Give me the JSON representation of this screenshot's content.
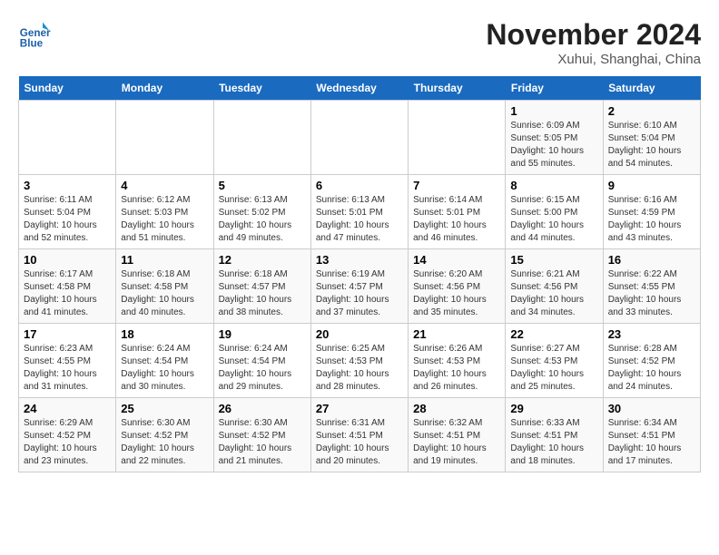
{
  "header": {
    "logo_text_line1": "General",
    "logo_text_line2": "Blue",
    "month_title": "November 2024",
    "location": "Xuhui, Shanghai, China"
  },
  "weekdays": [
    "Sunday",
    "Monday",
    "Tuesday",
    "Wednesday",
    "Thursday",
    "Friday",
    "Saturday"
  ],
  "weeks": [
    [
      {
        "day": "",
        "sunrise": "",
        "sunset": "",
        "daylight": ""
      },
      {
        "day": "",
        "sunrise": "",
        "sunset": "",
        "daylight": ""
      },
      {
        "day": "",
        "sunrise": "",
        "sunset": "",
        "daylight": ""
      },
      {
        "day": "",
        "sunrise": "",
        "sunset": "",
        "daylight": ""
      },
      {
        "day": "",
        "sunrise": "",
        "sunset": "",
        "daylight": ""
      },
      {
        "day": "1",
        "sunrise": "Sunrise: 6:09 AM",
        "sunset": "Sunset: 5:05 PM",
        "daylight": "Daylight: 10 hours and 55 minutes."
      },
      {
        "day": "2",
        "sunrise": "Sunrise: 6:10 AM",
        "sunset": "Sunset: 5:04 PM",
        "daylight": "Daylight: 10 hours and 54 minutes."
      }
    ],
    [
      {
        "day": "3",
        "sunrise": "Sunrise: 6:11 AM",
        "sunset": "Sunset: 5:04 PM",
        "daylight": "Daylight: 10 hours and 52 minutes."
      },
      {
        "day": "4",
        "sunrise": "Sunrise: 6:12 AM",
        "sunset": "Sunset: 5:03 PM",
        "daylight": "Daylight: 10 hours and 51 minutes."
      },
      {
        "day": "5",
        "sunrise": "Sunrise: 6:13 AM",
        "sunset": "Sunset: 5:02 PM",
        "daylight": "Daylight: 10 hours and 49 minutes."
      },
      {
        "day": "6",
        "sunrise": "Sunrise: 6:13 AM",
        "sunset": "Sunset: 5:01 PM",
        "daylight": "Daylight: 10 hours and 47 minutes."
      },
      {
        "day": "7",
        "sunrise": "Sunrise: 6:14 AM",
        "sunset": "Sunset: 5:01 PM",
        "daylight": "Daylight: 10 hours and 46 minutes."
      },
      {
        "day": "8",
        "sunrise": "Sunrise: 6:15 AM",
        "sunset": "Sunset: 5:00 PM",
        "daylight": "Daylight: 10 hours and 44 minutes."
      },
      {
        "day": "9",
        "sunrise": "Sunrise: 6:16 AM",
        "sunset": "Sunset: 4:59 PM",
        "daylight": "Daylight: 10 hours and 43 minutes."
      }
    ],
    [
      {
        "day": "10",
        "sunrise": "Sunrise: 6:17 AM",
        "sunset": "Sunset: 4:58 PM",
        "daylight": "Daylight: 10 hours and 41 minutes."
      },
      {
        "day": "11",
        "sunrise": "Sunrise: 6:18 AM",
        "sunset": "Sunset: 4:58 PM",
        "daylight": "Daylight: 10 hours and 40 minutes."
      },
      {
        "day": "12",
        "sunrise": "Sunrise: 6:18 AM",
        "sunset": "Sunset: 4:57 PM",
        "daylight": "Daylight: 10 hours and 38 minutes."
      },
      {
        "day": "13",
        "sunrise": "Sunrise: 6:19 AM",
        "sunset": "Sunset: 4:57 PM",
        "daylight": "Daylight: 10 hours and 37 minutes."
      },
      {
        "day": "14",
        "sunrise": "Sunrise: 6:20 AM",
        "sunset": "Sunset: 4:56 PM",
        "daylight": "Daylight: 10 hours and 35 minutes."
      },
      {
        "day": "15",
        "sunrise": "Sunrise: 6:21 AM",
        "sunset": "Sunset: 4:56 PM",
        "daylight": "Daylight: 10 hours and 34 minutes."
      },
      {
        "day": "16",
        "sunrise": "Sunrise: 6:22 AM",
        "sunset": "Sunset: 4:55 PM",
        "daylight": "Daylight: 10 hours and 33 minutes."
      }
    ],
    [
      {
        "day": "17",
        "sunrise": "Sunrise: 6:23 AM",
        "sunset": "Sunset: 4:55 PM",
        "daylight": "Daylight: 10 hours and 31 minutes."
      },
      {
        "day": "18",
        "sunrise": "Sunrise: 6:24 AM",
        "sunset": "Sunset: 4:54 PM",
        "daylight": "Daylight: 10 hours and 30 minutes."
      },
      {
        "day": "19",
        "sunrise": "Sunrise: 6:24 AM",
        "sunset": "Sunset: 4:54 PM",
        "daylight": "Daylight: 10 hours and 29 minutes."
      },
      {
        "day": "20",
        "sunrise": "Sunrise: 6:25 AM",
        "sunset": "Sunset: 4:53 PM",
        "daylight": "Daylight: 10 hours and 28 minutes."
      },
      {
        "day": "21",
        "sunrise": "Sunrise: 6:26 AM",
        "sunset": "Sunset: 4:53 PM",
        "daylight": "Daylight: 10 hours and 26 minutes."
      },
      {
        "day": "22",
        "sunrise": "Sunrise: 6:27 AM",
        "sunset": "Sunset: 4:53 PM",
        "daylight": "Daylight: 10 hours and 25 minutes."
      },
      {
        "day": "23",
        "sunrise": "Sunrise: 6:28 AM",
        "sunset": "Sunset: 4:52 PM",
        "daylight": "Daylight: 10 hours and 24 minutes."
      }
    ],
    [
      {
        "day": "24",
        "sunrise": "Sunrise: 6:29 AM",
        "sunset": "Sunset: 4:52 PM",
        "daylight": "Daylight: 10 hours and 23 minutes."
      },
      {
        "day": "25",
        "sunrise": "Sunrise: 6:30 AM",
        "sunset": "Sunset: 4:52 PM",
        "daylight": "Daylight: 10 hours and 22 minutes."
      },
      {
        "day": "26",
        "sunrise": "Sunrise: 6:30 AM",
        "sunset": "Sunset: 4:52 PM",
        "daylight": "Daylight: 10 hours and 21 minutes."
      },
      {
        "day": "27",
        "sunrise": "Sunrise: 6:31 AM",
        "sunset": "Sunset: 4:51 PM",
        "daylight": "Daylight: 10 hours and 20 minutes."
      },
      {
        "day": "28",
        "sunrise": "Sunrise: 6:32 AM",
        "sunset": "Sunset: 4:51 PM",
        "daylight": "Daylight: 10 hours and 19 minutes."
      },
      {
        "day": "29",
        "sunrise": "Sunrise: 6:33 AM",
        "sunset": "Sunset: 4:51 PM",
        "daylight": "Daylight: 10 hours and 18 minutes."
      },
      {
        "day": "30",
        "sunrise": "Sunrise: 6:34 AM",
        "sunset": "Sunset: 4:51 PM",
        "daylight": "Daylight: 10 hours and 17 minutes."
      }
    ]
  ]
}
